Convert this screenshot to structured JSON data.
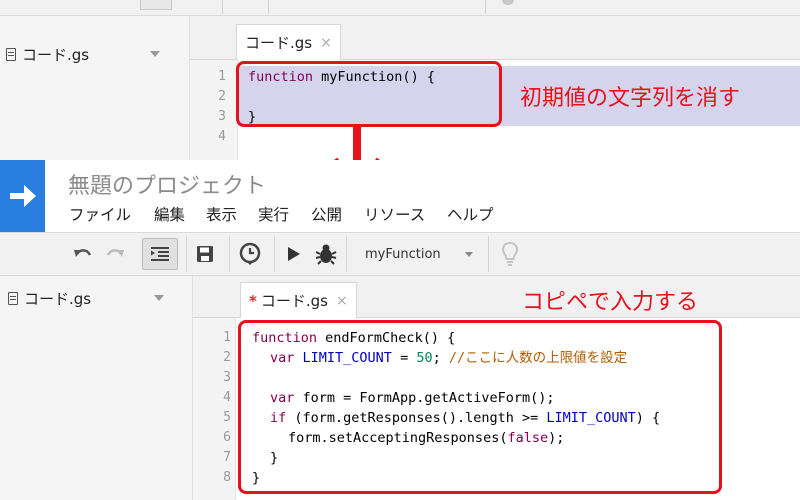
{
  "top_editor": {
    "file_name": "コード.gs",
    "tab_label": "コード.gs",
    "tab_close": "×",
    "line_numbers": [
      "1",
      "2",
      "3",
      "4"
    ],
    "code_lines": [
      "function myFunction() {",
      "",
      "}"
    ],
    "annotation": "初期値の文字列を消す"
  },
  "header": {
    "title": "無題のプロジェクト",
    "menu": [
      "ファイル",
      "編集",
      "表示",
      "実行",
      "公開",
      "リソース",
      "ヘルプ"
    ]
  },
  "toolbar": {
    "function_select": "myFunction",
    "icons": [
      "undo-icon",
      "redo-icon",
      "indent-icon",
      "save-icon",
      "trigger-clock-icon",
      "run-icon",
      "debug-icon",
      "lightbulb-icon"
    ]
  },
  "bottom_editor": {
    "file_name": "コード.gs",
    "tab_dirty_mark": "*",
    "tab_label": "コード.gs",
    "tab_close": "×",
    "line_numbers": [
      "1",
      "2",
      "3",
      "4",
      "5",
      "6",
      "7",
      "8"
    ],
    "code": {
      "l1_kw": "function",
      "l1_rest": " endFormCheck() {",
      "l2_kw": "var",
      "l2_var": "LIMIT_COUNT",
      "l2_eq": " = ",
      "l2_num": "50",
      "l2_semi": "; ",
      "l2_comment": "//ここに人数の上限値を設定",
      "l4_kw": "var",
      "l4_rest": " form = FormApp.getActiveForm();",
      "l5_kw": "if",
      "l5_rest": " (form.getResponses().length >= ",
      "l5_var": "LIMIT_COUNT",
      "l5_end": ") {",
      "l6_pre": "form.setAcceptingResponses(",
      "l6_bool": "false",
      "l6_end": ");",
      "l7": "}",
      "l8": "}"
    },
    "annotation": "コピペで入力する"
  },
  "colors": {
    "annotation_red": "#e5121d",
    "logo_blue": "#2a7ee0",
    "selection": "#d6d3ec"
  }
}
